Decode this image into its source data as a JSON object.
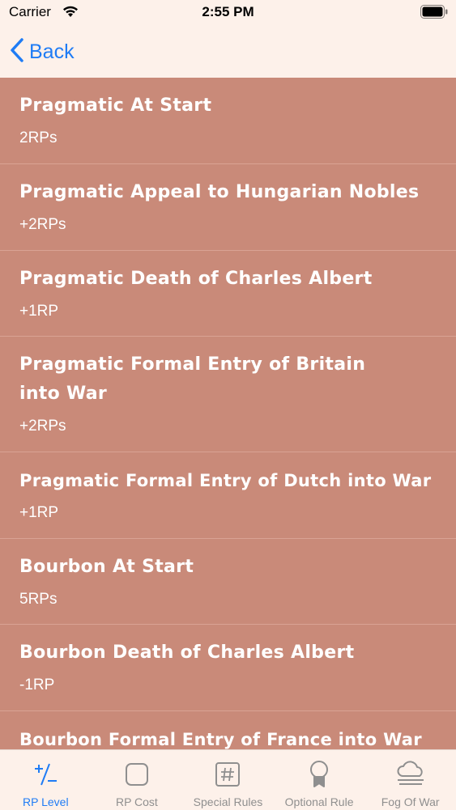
{
  "status_bar": {
    "carrier": "Carrier",
    "time": "2:55 PM"
  },
  "nav": {
    "back_label": "Back"
  },
  "list": {
    "items": [
      {
        "title": "Pragmatic At Start",
        "cost": "2RPs"
      },
      {
        "title": "Pragmatic Appeal to Hungarian Nobles",
        "cost": "+2RPs"
      },
      {
        "title": "Pragmatic Death of Charles Albert",
        "cost": "+1RP"
      },
      {
        "title": "Pragmatic Formal Entry of Britain into War",
        "cost": "+2RPs"
      },
      {
        "title": "Pragmatic Formal Entry of Dutch into War",
        "cost": "+1RP"
      },
      {
        "title": "Bourbon At Start",
        "cost": "5RPs"
      },
      {
        "title": "Bourbon Death of Charles Albert",
        "cost": "-1RP"
      },
      {
        "title": "Bourbon Formal Entry of France into War",
        "cost": ""
      }
    ]
  },
  "tab_bar": {
    "tabs": [
      {
        "label": "RP Level",
        "icon": "plus-minus-icon",
        "active": true
      },
      {
        "label": "RP Cost",
        "icon": "rounded-square-icon",
        "active": false
      },
      {
        "label": "Special Rules",
        "icon": "hash-icon",
        "active": false
      },
      {
        "label": "Optional Rule",
        "icon": "award-ribbon-icon",
        "active": false
      },
      {
        "label": "Fog Of War",
        "icon": "fog-cloud-icon",
        "active": false
      }
    ]
  },
  "colors": {
    "accent": "#1f7cf5",
    "list_background": "#c98a79",
    "page_background": "#fdf1ea",
    "inactive_tab": "#8f8f8f"
  }
}
